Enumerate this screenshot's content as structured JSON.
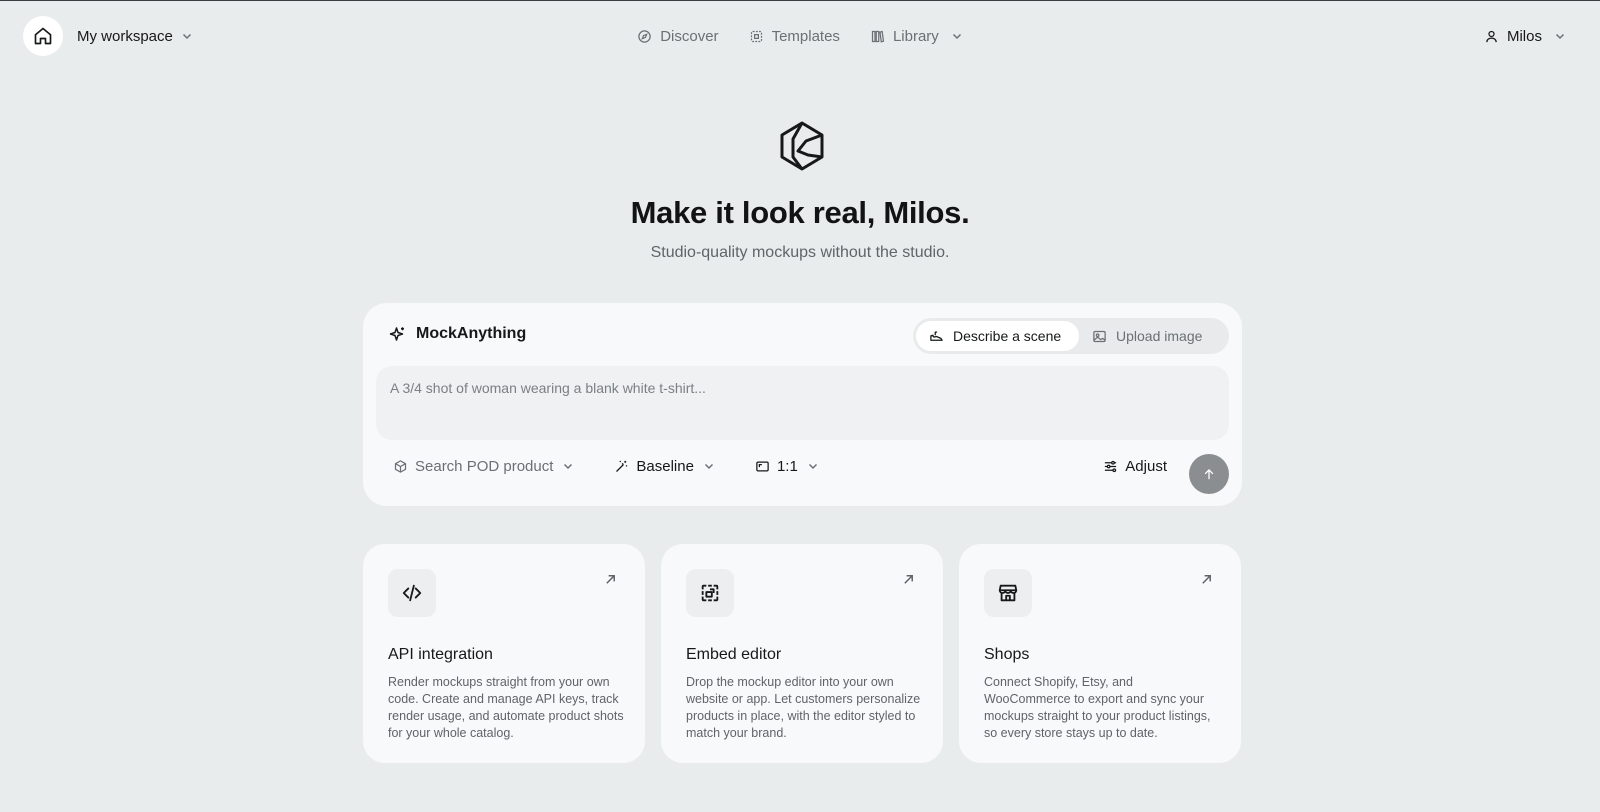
{
  "topbar": {
    "workspace_label": "My workspace",
    "nav": [
      {
        "label": "Discover",
        "icon": "compass-icon"
      },
      {
        "label": "Templates",
        "icon": "templates-icon"
      },
      {
        "label": "Library",
        "icon": "library-icon",
        "has_dropdown": true
      }
    ],
    "user_name": "Milos"
  },
  "hero": {
    "headline": "Make it look real, Milos.",
    "subline": "Studio-quality mockups without the studio."
  },
  "composer": {
    "brand_label": "MockAnything",
    "modes": [
      {
        "label": "Describe a scene",
        "active": true
      },
      {
        "label": "Upload image",
        "active": false
      }
    ],
    "prompt_placeholder": "A 3/4 shot of woman wearing a blank white t-shirt...",
    "product_label": "Search POD product",
    "model_label": "Baseline",
    "ratio_label": "1:1",
    "adjust_label": "Adjust"
  },
  "cards": [
    {
      "title": "API integration",
      "description": "Render mockups straight from your own code. Create and manage API keys, track render usage, and automate product shots for your whole catalog.",
      "icon": "code-icon"
    },
    {
      "title": "Embed editor",
      "description": "Drop the mockup editor into your own website or app. Let customers personalize products in place, with the editor styled to match your brand.",
      "icon": "embed-icon"
    },
    {
      "title": "Shops",
      "description": "Connect Shopify, Etsy, and WooCommerce to export and sync your mockups straight to your product listings, so every store stays up to date.",
      "icon": "store-icon"
    }
  ],
  "colors": {
    "background": "#e9eced",
    "card": "#f8f9fa",
    "text": "#16181a",
    "muted": "#6b7075",
    "send_button": "#8b8e90"
  }
}
